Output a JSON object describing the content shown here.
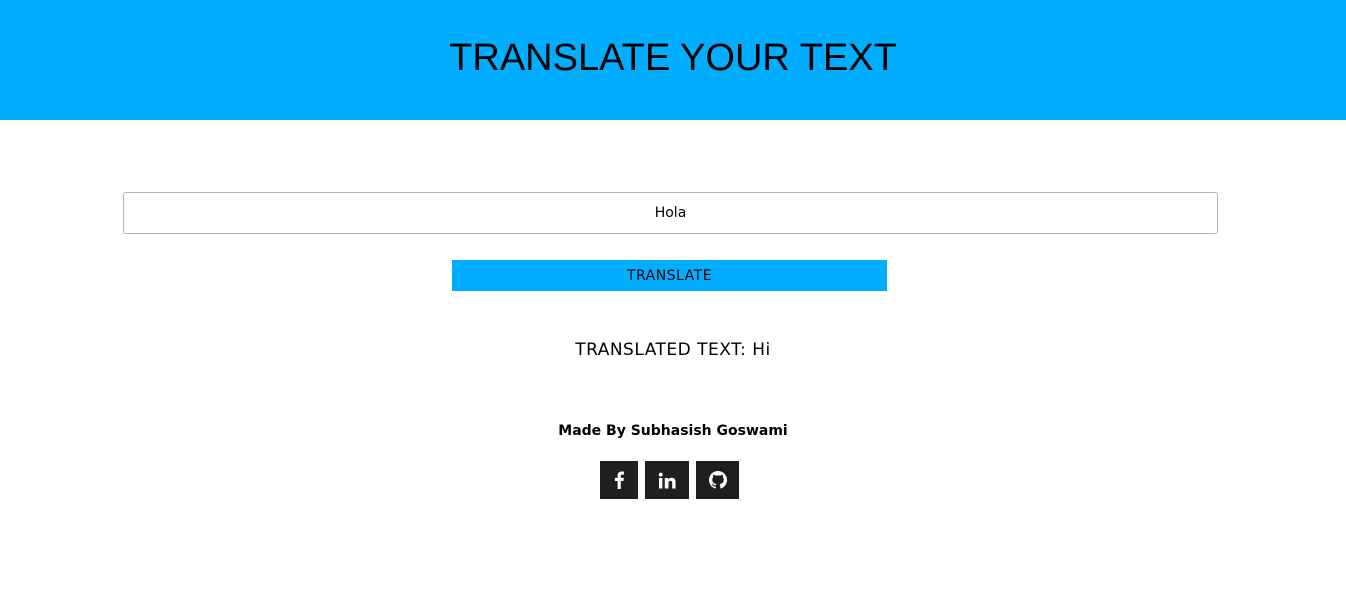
{
  "header": {
    "title": "TRANSLATE YOUR TEXT",
    "background_color": "#00adff"
  },
  "input": {
    "value": "Hola"
  },
  "translate_button": {
    "label": "TRANSLATE",
    "background_color": "#00adff"
  },
  "output": {
    "label": "TRANSLATED TEXT:",
    "value": "Hi"
  },
  "footer": {
    "credit": "Made By Subhasish Goswami",
    "social_links": [
      {
        "icon": "facebook-icon"
      },
      {
        "icon": "linkedin-icon"
      },
      {
        "icon": "github-icon"
      }
    ],
    "icon_background": "#1f1f1f"
  }
}
